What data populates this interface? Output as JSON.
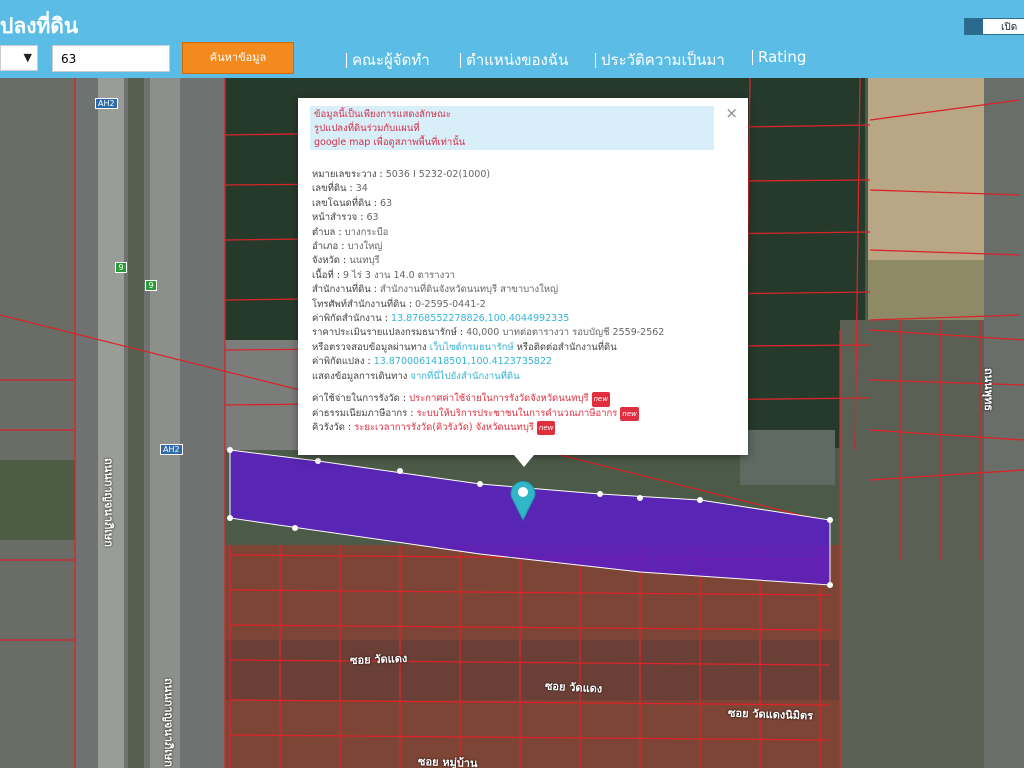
{
  "header": {
    "title": "ปลงที่ดิน",
    "toggle_label": "เปิด",
    "select_value": "",
    "search_value": "63",
    "search_button": "ค้นหาข้อมูล",
    "nav": [
      {
        "label": "คณะผู้จัดทำ"
      },
      {
        "label": "ตำแหน่งของฉัน"
      },
      {
        "label": "ประวัติความเป็นมา"
      },
      {
        "label": "Rating"
      }
    ]
  },
  "popup": {
    "close": "×",
    "disclaimer": [
      "ข้อมูลนี้เป็นเพียงการแสดงลักษณะ",
      "รูปแปลงที่ดินร่วมกับแผนที่",
      "google map เพื่อดูสภาพพื้นที่เท่านั้น"
    ],
    "fields": {
      "map_sheet": {
        "label": "หมายเลขระวาง",
        "value": "5036 I 5232-02(1000)"
      },
      "land_no": {
        "label": "เลขที่ดิน",
        "value": "34"
      },
      "deed_no": {
        "label": "เลขโฉนดที่ดิน",
        "value": "63"
      },
      "survey_page": {
        "label": "หน้าสำรวจ",
        "value": "63"
      },
      "subdistrict": {
        "label": "ตำบล",
        "value": "บางกระบือ"
      },
      "district": {
        "label": "อำเภอ",
        "value": "บางใหญ่"
      },
      "province": {
        "label": "จังหวัด",
        "value": "นนทบุรี"
      },
      "area": {
        "label": "เนื้อที่",
        "value": "9 ไร่ 3 งาน 14.0 ตารางวา"
      },
      "land_office": {
        "label": "สำนักงานที่ดิน",
        "value": "สำนักงานที่ดินจังหวัดนนทบุรี สาขาบางใหญ่"
      },
      "office_phone": {
        "label": "โทรศัพท์สำนักงานที่ดิน",
        "value": "0-2595-0441-2"
      },
      "office_coords": {
        "label": "ค่าพิกัดสำนักงาน",
        "value": "13.8768552278826,100.4044992335"
      },
      "appraisal": {
        "label": "ราคาประเมินรายแปลงกรมธนารักษ์",
        "value": "40,000 บาทต่อตารางวา รอบบัญชี 2559-2562"
      },
      "check_prefix": "หรือตรวจสอบข้อมูลผ่านทาง",
      "check_link": "เว็บไซต์กรมธนารักษ์",
      "check_suffix": "หรือติดต่อสำนักงานที่ดิน",
      "parcel_coords": {
        "label": "ค่าพิกัดแปลง",
        "value": "13.8700061418501,100.4123735822"
      },
      "route": {
        "label": "แสดงข้อมูลการเดินทาง",
        "value": "จากที่นี่ไปยังสำนักงานที่ดิน"
      },
      "cost": {
        "label": "ค่าใช้จ่ายในการรังวัด",
        "value": "ประกาศค่าใช้จ่ายในการรังวัดจังหวัดนนทบุรี",
        "badge": "new"
      },
      "fee": {
        "label": "ค่าธรรมเนียมภาษีอากร",
        "value": "ระบบให้บริการประชาชนในการคำนวณภาษีอากร",
        "badge": "new"
      },
      "queue": {
        "label": "คิวรังวัด",
        "value": "ระยะเวลาการรังวัด(คิวรังวัด) จังหวัดนนทบุรี",
        "badge": "new"
      }
    }
  },
  "map": {
    "road_labels": [
      "ถนนกาญจนาภิเษก",
      "ถนนกาญจนาภิเษก",
      "ซอย วัดแดง",
      "ซอย วัดแดง",
      "ซอย วัดแดงนิมิตร",
      "ซอย หมู่บ้าน",
      "ถนนพุทธ"
    ],
    "highway_shields": [
      "AH2",
      "AH2"
    ],
    "green_signs": [
      "9",
      "9"
    ],
    "colors": {
      "parcel": "#5a1cc8",
      "boundary": "#d8242a",
      "header": "#5bbde6",
      "button": "#f28a1e",
      "marker": "#31b6c8"
    }
  }
}
